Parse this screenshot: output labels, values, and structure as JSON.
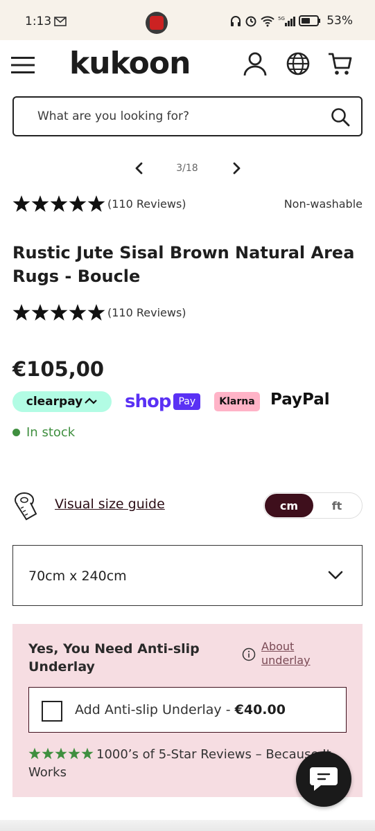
{
  "status_bar": {
    "time": "1:13",
    "battery_percent": "53%",
    "icons": [
      "mail-icon",
      "app-icon",
      "headphones-icon",
      "alarm-icon",
      "wifi-icon",
      "5g-signal-icon",
      "battery-icon"
    ]
  },
  "header": {
    "logo": "kukoon",
    "icons": [
      "menu-icon",
      "account-icon",
      "globe-icon",
      "cart-icon"
    ]
  },
  "search": {
    "placeholder": "What are you looking for?"
  },
  "gallery": {
    "counter": "3/18"
  },
  "product": {
    "rating_stars": 5,
    "reviews_top": "(110 Reviews)",
    "washable": "Non-washable",
    "title": "Rustic Jute Sisal Brown Natural Area Rugs - Boucle",
    "reviews_title": "(110 Reviews)",
    "price": "€105,00",
    "stock": "In stock"
  },
  "payments": {
    "clearpay": "clearpay",
    "shop": "shop",
    "shop_pay": "Pay",
    "klarna": "Klarna",
    "paypal": "PayPal"
  },
  "size_guide": {
    "link": "Visual size guide",
    "unit_cm": "cm",
    "unit_ft": "ft",
    "selected_unit": "cm"
  },
  "size_select": {
    "value": "70cm x 240cm"
  },
  "underlay": {
    "title": "Yes, You Need Anti-slip Underlay",
    "about": "About underlay",
    "option_label": "Add Anti-slip Underlay - ",
    "option_price": "€40.00",
    "checked": false,
    "reviews_text": "1000’s of 5-Star Reviews – Because It Works"
  },
  "colors": {
    "accent_dark": "#3e0f1c",
    "stock_green": "#3f8f3f",
    "underlay_bg": "#f6dde2",
    "clearpay": "#b2fce4",
    "shop_purple": "#5a31f4",
    "klarna_pink": "#ffb3c7"
  }
}
